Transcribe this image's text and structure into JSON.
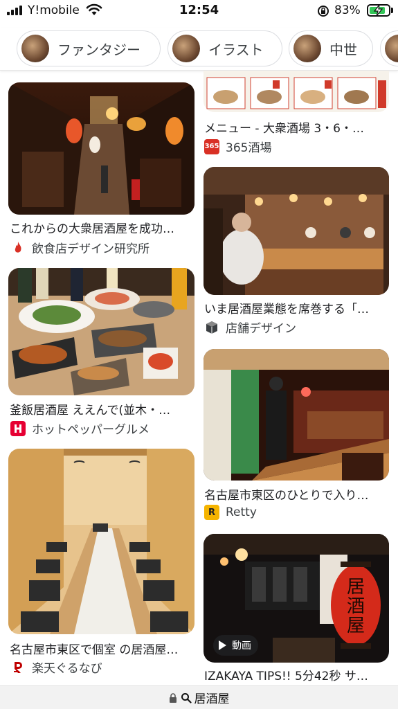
{
  "status_bar": {
    "carrier": "Y!mobile",
    "time": "12:54",
    "battery_percent": "83%",
    "battery_level": 0.83,
    "icons": [
      "signal-icon",
      "wifi-icon",
      "orientation-lock-icon",
      "battery-charging-icon"
    ]
  },
  "chips": [
    {
      "label": "ファンタジー"
    },
    {
      "label": "イラスト"
    },
    {
      "label": "中世"
    }
  ],
  "results": {
    "left": [
      {
        "title": "これからの大衆居酒屋を成功…",
        "source": "飲食店デザイン研究所",
        "source_icon": "flame-logo-icon",
        "source_color": "#d93025"
      },
      {
        "title": "釜飯居酒屋 ええんで(並木・…",
        "source": "ホットペッパーグルメ",
        "source_icon": "hotpepper-logo-icon",
        "source_color": "#e60033"
      },
      {
        "title": "名古屋市東区で個室 の居酒屋…",
        "source": "楽天ぐるなび",
        "source_icon": "rakuten-logo-icon",
        "source_color": "#bf0000"
      }
    ],
    "right": [
      {
        "title": "メニュー - 大衆酒場 3・6・…",
        "source": "365酒場",
        "source_icon": "365-logo-icon",
        "source_color": "#d93025",
        "icon_text": "365"
      },
      {
        "title": "いま居酒屋業態を席巻する「…",
        "source": "店舗デザイン",
        "source_icon": "cube-logo-icon",
        "source_color": "#3c4043"
      },
      {
        "title": "名古屋市東区のひとりで入り…",
        "source": "Retty",
        "source_icon": "retty-logo-icon",
        "source_color": "#f5b400",
        "icon_text": "R"
      },
      {
        "title": "IZAKAYA TIPS!! 5分42秒 サ…",
        "badge": "動画"
      }
    ]
  },
  "url_bar": {
    "text": "居酒屋"
  }
}
